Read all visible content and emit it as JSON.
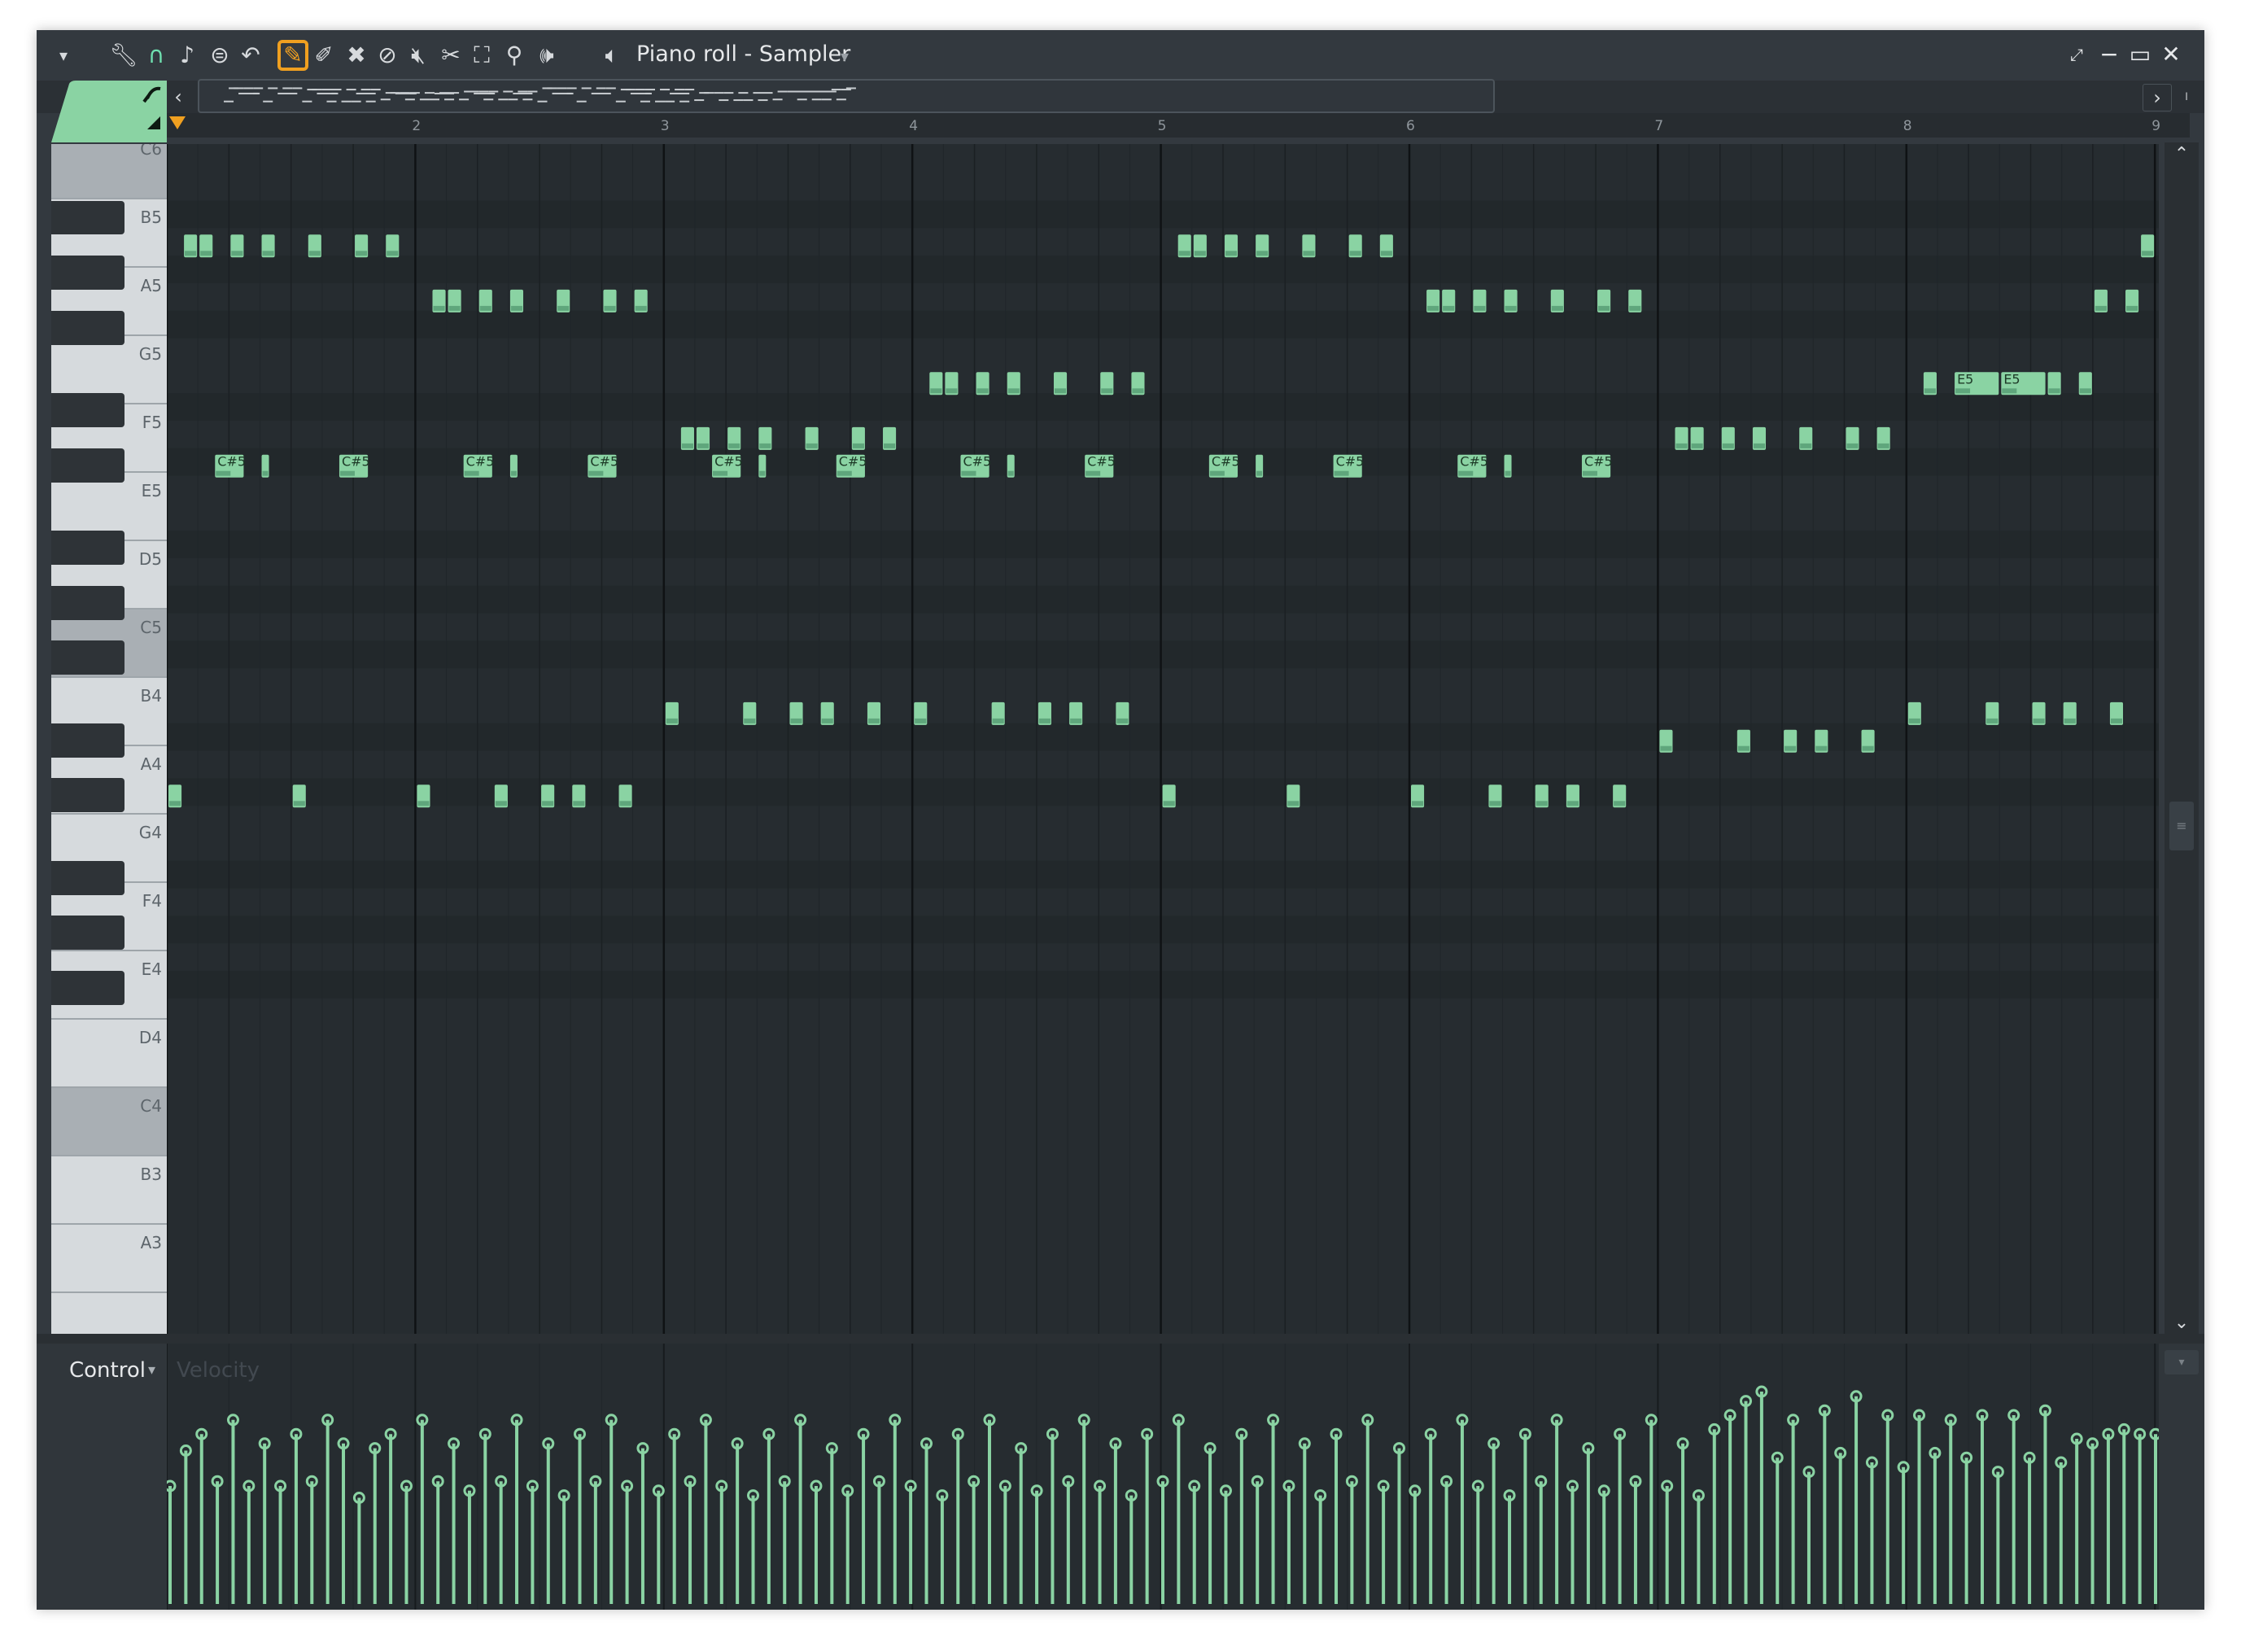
{
  "window": {
    "title": "Piano roll - Sampler",
    "title_caret": "▾",
    "controls": [
      "minimize",
      "maximize",
      "close"
    ]
  },
  "toolbar": {
    "menu_caret": "▾",
    "tools": [
      {
        "name": "wrench-icon",
        "glyph": "🔧︎"
      },
      {
        "name": "magnet-icon",
        "glyph": "∩"
      },
      {
        "name": "note-icon",
        "glyph": "♪"
      },
      {
        "name": "stamp-icon",
        "glyph": "⊜"
      },
      {
        "name": "undo-icon",
        "glyph": "↶"
      },
      {
        "name": "draw-pencil-icon",
        "glyph": "✎",
        "active": true
      },
      {
        "name": "paint-brush-icon",
        "glyph": "✐"
      },
      {
        "name": "delete-icon",
        "glyph": "✖"
      },
      {
        "name": "mute-icon",
        "glyph": "⊘"
      },
      {
        "name": "mute-speaker-icon",
        "glyph": "🔇︎"
      },
      {
        "name": "slice-icon",
        "glyph": "✂"
      },
      {
        "name": "select-icon",
        "glyph": "⛶"
      },
      {
        "name": "zoom-icon",
        "glyph": "⚲"
      },
      {
        "name": "playback-icon",
        "glyph": "🕪︎"
      }
    ],
    "speaker_glyph": "🔈︎",
    "accent": "#f0a020"
  },
  "scroll": {
    "left": "‹",
    "right": "›",
    "up": "⌃",
    "down": "⌄",
    "end": "⏽"
  },
  "ruler": {
    "bars": [
      "2",
      "3",
      "4",
      "5",
      "6",
      "7",
      "8",
      "9"
    ]
  },
  "keyboard": {
    "labels": [
      "C6",
      "B5",
      "A5",
      "G5",
      "F5",
      "E5",
      "D5",
      "C5",
      "B4",
      "A4",
      "G4",
      "F4",
      "E4",
      "D4",
      "C4",
      "B3",
      "A3"
    ]
  },
  "colors": {
    "note_fill": "#8ad3a3",
    "note_dark": "#5fa67c",
    "note_label": "#1d3a27",
    "grid_bg": "#262c30",
    "grid_row_black": "#22282b",
    "beat_line": "#1b2023",
    "bar_line": "#0f1214",
    "velocity_line": "#8ad3a3"
  },
  "notes": [
    {
      "pitch": "A5",
      "start": 0.125,
      "len": 0.125
    },
    {
      "pitch": "A5",
      "start": 0.25,
      "len": 0.125
    },
    {
      "pitch": "A5",
      "start": 0.5,
      "len": 0.125
    },
    {
      "pitch": "A5",
      "start": 0.75,
      "len": 0.125
    },
    {
      "pitch": "A5",
      "start": 1.125,
      "len": 0.125
    },
    {
      "pitch": "A5",
      "start": 1.5,
      "len": 0.125
    },
    {
      "pitch": "A5",
      "start": 1.75,
      "len": 0.125
    },
    {
      "pitch": "G5",
      "start": 2.125,
      "len": 0.125
    },
    {
      "pitch": "G5",
      "start": 2.25,
      "len": 0.125
    },
    {
      "pitch": "G5",
      "start": 2.5,
      "len": 0.125
    },
    {
      "pitch": "G5",
      "start": 2.75,
      "len": 0.125
    },
    {
      "pitch": "G5",
      "start": 3.125,
      "len": 0.125
    },
    {
      "pitch": "G5",
      "start": 3.5,
      "len": 0.125
    },
    {
      "pitch": "G5",
      "start": 3.75,
      "len": 0.125
    },
    {
      "pitch": "D5",
      "start": 4.125,
      "len": 0.125
    },
    {
      "pitch": "D5",
      "start": 4.25,
      "len": 0.125
    },
    {
      "pitch": "D5",
      "start": 4.5,
      "len": 0.125
    },
    {
      "pitch": "D5",
      "start": 4.75,
      "len": 0.125
    },
    {
      "pitch": "D5",
      "start": 5.125,
      "len": 0.125
    },
    {
      "pitch": "D5",
      "start": 5.5,
      "len": 0.125
    },
    {
      "pitch": "D5",
      "start": 5.75,
      "len": 0.125
    },
    {
      "pitch": "E5",
      "start": 6.125,
      "len": 0.125
    },
    {
      "pitch": "E5",
      "start": 6.25,
      "len": 0.125
    },
    {
      "pitch": "E5",
      "start": 6.5,
      "len": 0.125
    },
    {
      "pitch": "E5",
      "start": 6.75,
      "len": 0.125
    },
    {
      "pitch": "E5",
      "start": 7.125,
      "len": 0.125
    },
    {
      "pitch": "E5",
      "start": 7.5,
      "len": 0.125
    },
    {
      "pitch": "E5",
      "start": 7.75,
      "len": 0.125
    },
    {
      "pitch": "A5",
      "start": 8.125,
      "len": 0.125
    },
    {
      "pitch": "A5",
      "start": 8.25,
      "len": 0.125
    },
    {
      "pitch": "A5",
      "start": 8.5,
      "len": 0.125
    },
    {
      "pitch": "A5",
      "start": 8.75,
      "len": 0.125
    },
    {
      "pitch": "A5",
      "start": 9.125,
      "len": 0.125
    },
    {
      "pitch": "A5",
      "start": 9.5,
      "len": 0.125
    },
    {
      "pitch": "A5",
      "start": 9.75,
      "len": 0.125
    },
    {
      "pitch": "G5",
      "start": 10.125,
      "len": 0.125
    },
    {
      "pitch": "G5",
      "start": 10.25,
      "len": 0.125
    },
    {
      "pitch": "G5",
      "start": 10.5,
      "len": 0.125
    },
    {
      "pitch": "G5",
      "start": 10.75,
      "len": 0.125
    },
    {
      "pitch": "G5",
      "start": 11.125,
      "len": 0.125
    },
    {
      "pitch": "G5",
      "start": 11.5,
      "len": 0.125
    },
    {
      "pitch": "G5",
      "start": 11.75,
      "len": 0.125
    },
    {
      "pitch": "D5",
      "start": 12.125,
      "len": 0.125
    },
    {
      "pitch": "D5",
      "start": 12.25,
      "len": 0.125
    },
    {
      "pitch": "D5",
      "start": 12.5,
      "len": 0.125
    },
    {
      "pitch": "D5",
      "start": 12.75,
      "len": 0.125
    },
    {
      "pitch": "D5",
      "start": 13.125,
      "len": 0.125
    },
    {
      "pitch": "D5",
      "start": 13.5,
      "len": 0.125
    },
    {
      "pitch": "D5",
      "start": 13.75,
      "len": 0.125
    },
    {
      "pitch": "E5",
      "start": 14.125,
      "len": 0.125
    },
    {
      "pitch": "E5",
      "start": 14.375,
      "len": 0.375,
      "label": "E5"
    },
    {
      "pitch": "E5",
      "start": 14.75,
      "len": 0.375,
      "label": "E5"
    },
    {
      "pitch": "E5",
      "start": 15.125,
      "len": 0.125
    },
    {
      "pitch": "E5",
      "start": 15.375,
      "len": 0.125
    },
    {
      "pitch": "A5",
      "start": 15.875,
      "len": 0.125
    },
    {
      "pitch": "G5",
      "start": 15.5,
      "len": 0.125
    },
    {
      "pitch": "G5",
      "start": 15.75,
      "len": 0.125
    },
    {
      "pitch": "C#5",
      "start": 0.375,
      "len": 0.25,
      "label": "C#5"
    },
    {
      "pitch": "C#5",
      "start": 0.75,
      "len": 0.0625
    },
    {
      "pitch": "C#5",
      "start": 1.375,
      "len": 0.25,
      "label": "C#5"
    },
    {
      "pitch": "C#5",
      "start": 2.375,
      "len": 0.25,
      "label": "C#5"
    },
    {
      "pitch": "C#5",
      "start": 2.75,
      "len": 0.0625
    },
    {
      "pitch": "C#5",
      "start": 3.375,
      "len": 0.25,
      "label": "C#5"
    },
    {
      "pitch": "C#5",
      "start": 4.375,
      "len": 0.25,
      "label": "C#5"
    },
    {
      "pitch": "C#5",
      "start": 4.75,
      "len": 0.0625
    },
    {
      "pitch": "C#5",
      "start": 5.375,
      "len": 0.25,
      "label": "C#5"
    },
    {
      "pitch": "C#5",
      "start": 6.375,
      "len": 0.25,
      "label": "C#5"
    },
    {
      "pitch": "C#5",
      "start": 6.75,
      "len": 0.0625
    },
    {
      "pitch": "C#5",
      "start": 7.375,
      "len": 0.25,
      "label": "C#5"
    },
    {
      "pitch": "C#5",
      "start": 8.375,
      "len": 0.25,
      "label": "C#5"
    },
    {
      "pitch": "C#5",
      "start": 8.75,
      "len": 0.0625
    },
    {
      "pitch": "C#5",
      "start": 9.375,
      "len": 0.25,
      "label": "C#5"
    },
    {
      "pitch": "C#5",
      "start": 10.375,
      "len": 0.25,
      "label": "C#5"
    },
    {
      "pitch": "C#5",
      "start": 10.75,
      "len": 0.0625
    },
    {
      "pitch": "C#5",
      "start": 11.375,
      "len": 0.25,
      "label": "C#5"
    },
    {
      "pitch": "E4",
      "start": 4.0,
      "len": 0.125
    },
    {
      "pitch": "E4",
      "start": 4.625,
      "len": 0.125
    },
    {
      "pitch": "E4",
      "start": 5.0,
      "len": 0.125
    },
    {
      "pitch": "E4",
      "start": 5.25,
      "len": 0.125
    },
    {
      "pitch": "E4",
      "start": 5.625,
      "len": 0.125
    },
    {
      "pitch": "E4",
      "start": 6.0,
      "len": 0.125
    },
    {
      "pitch": "E4",
      "start": 6.625,
      "len": 0.125
    },
    {
      "pitch": "E4",
      "start": 7.0,
      "len": 0.125
    },
    {
      "pitch": "E4",
      "start": 7.25,
      "len": 0.125
    },
    {
      "pitch": "E4",
      "start": 7.625,
      "len": 0.125
    },
    {
      "pitch": "E4",
      "start": 14.0,
      "len": 0.125
    },
    {
      "pitch": "E4",
      "start": 14.625,
      "len": 0.125
    },
    {
      "pitch": "E4",
      "start": 15.0,
      "len": 0.125
    },
    {
      "pitch": "E4",
      "start": 15.25,
      "len": 0.125
    },
    {
      "pitch": "E4",
      "start": 15.625,
      "len": 0.125
    },
    {
      "pitch": "D#4",
      "start": 12.0,
      "len": 0.125
    },
    {
      "pitch": "D#4",
      "start": 12.625,
      "len": 0.125
    },
    {
      "pitch": "D#4",
      "start": 13.0,
      "len": 0.125
    },
    {
      "pitch": "D#4",
      "start": 13.25,
      "len": 0.125
    },
    {
      "pitch": "D#4",
      "start": 13.625,
      "len": 0.125
    },
    {
      "pitch": "C#4",
      "start": 0.0,
      "len": 0.125
    },
    {
      "pitch": "C#4",
      "start": 1.0,
      "len": 0.125
    },
    {
      "pitch": "C#4",
      "start": 2.0,
      "len": 0.125
    },
    {
      "pitch": "C#4",
      "start": 2.625,
      "len": 0.125
    },
    {
      "pitch": "C#4",
      "start": 3.0,
      "len": 0.125
    },
    {
      "pitch": "C#4",
      "start": 3.25,
      "len": 0.125
    },
    {
      "pitch": "C#4",
      "start": 3.625,
      "len": 0.125
    },
    {
      "pitch": "C#4",
      "start": 8.0,
      "len": 0.125
    },
    {
      "pitch": "C#4",
      "start": 9.0,
      "len": 0.125
    },
    {
      "pitch": "C#4",
      "start": 10.0,
      "len": 0.125
    },
    {
      "pitch": "C#4",
      "start": 10.625,
      "len": 0.125
    },
    {
      "pitch": "C#4",
      "start": 11.0,
      "len": 0.125
    },
    {
      "pitch": "C#4",
      "start": 11.25,
      "len": 0.125
    },
    {
      "pitch": "C#4",
      "start": 11.625,
      "len": 0.125
    }
  ],
  "control": {
    "label": "Control",
    "caret": "▾",
    "parameter": "Velocity"
  },
  "velocities": [
    0.5,
    0.65,
    0.72,
    0.52,
    0.78,
    0.5,
    0.68,
    0.5,
    0.72,
    0.52,
    0.78,
    0.68,
    0.45,
    0.66,
    0.72,
    0.5,
    0.78,
    0.52,
    0.68,
    0.48,
    0.72,
    0.52,
    0.78,
    0.5,
    0.68,
    0.46,
    0.72,
    0.52,
    0.78,
    0.5,
    0.66,
    0.48,
    0.72,
    0.52,
    0.78,
    0.5,
    0.68,
    0.46,
    0.72,
    0.52,
    0.78,
    0.5,
    0.66,
    0.48,
    0.72,
    0.52,
    0.78,
    0.5,
    0.68,
    0.46,
    0.72,
    0.52,
    0.78,
    0.5,
    0.66,
    0.48,
    0.72,
    0.52,
    0.78,
    0.5,
    0.68,
    0.46,
    0.72,
    0.52,
    0.78,
    0.5,
    0.66,
    0.48,
    0.72,
    0.52,
    0.78,
    0.5,
    0.68,
    0.46,
    0.72,
    0.52,
    0.78,
    0.5,
    0.66,
    0.48,
    0.72,
    0.52,
    0.78,
    0.5,
    0.68,
    0.46,
    0.72,
    0.52,
    0.78,
    0.5,
    0.66,
    0.48,
    0.72,
    0.52,
    0.78,
    0.5,
    0.68,
    0.46,
    0.74,
    0.8,
    0.86,
    0.9,
    0.62,
    0.78,
    0.56,
    0.82,
    0.64,
    0.88,
    0.6,
    0.8,
    0.58,
    0.8,
    0.64,
    0.78,
    0.62,
    0.8,
    0.56,
    0.8,
    0.62,
    0.82,
    0.6,
    0.7,
    0.68,
    0.72,
    0.74,
    0.72,
    0.72
  ]
}
